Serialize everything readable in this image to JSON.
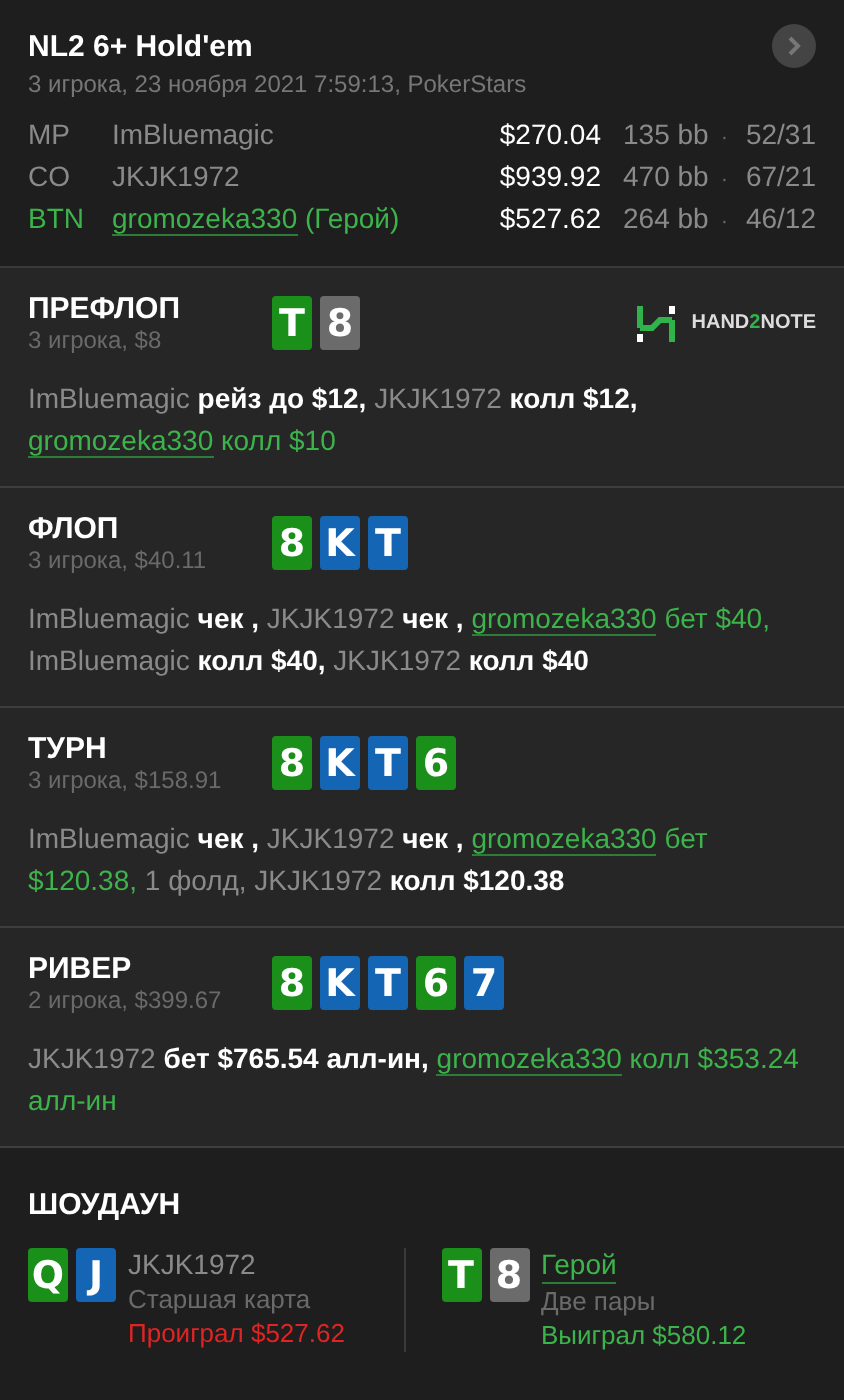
{
  "header": {
    "title": "NL2 6+ Hold'em",
    "subtitle": "3 игрока, 23 ноября 2021 7:59:13, PokerStars"
  },
  "players": [
    {
      "position": "MP",
      "name": "ImBluemagic",
      "hero": false,
      "stack": "$270.04",
      "bb": "135 bb",
      "sep": "·",
      "stats": "52/31"
    },
    {
      "position": "CO",
      "name": "JKJK1972",
      "hero": false,
      "stack": "$939.92",
      "bb": "470 bb",
      "sep": "·",
      "stats": "67/21"
    },
    {
      "position": "BTN",
      "name": "gromozeka330",
      "hero": true,
      "hero_tag": " (Герой)",
      "stack": "$527.62",
      "bb": "264 bb",
      "sep": "·",
      "stats": "46/12"
    }
  ],
  "logo": {
    "before": "HAND",
    "accent": "2",
    "after": "NOTE"
  },
  "streets": [
    {
      "name": "ПРЕФЛОП",
      "info": "3 игрока, $8",
      "logo": true,
      "cards": [
        {
          "rank": "T",
          "color": "#1a8f1a"
        },
        {
          "rank": "8",
          "color": "#6b6b6b"
        }
      ],
      "actions": [
        {
          "kind": "player",
          "text": "ImBluemagic"
        },
        {
          "kind": "action",
          "text": " рейз до $12, "
        },
        {
          "kind": "player",
          "text": "JKJK1972"
        },
        {
          "kind": "action",
          "text": " колл $12, "
        },
        {
          "kind": "hero",
          "text": "gromozeka330"
        },
        {
          "kind": "hero-action",
          "text": " колл $10"
        }
      ]
    },
    {
      "name": "ФЛОП",
      "info": "3 игрока, $40.11",
      "logo": false,
      "cards": [
        {
          "rank": "8",
          "color": "#1a8f1a"
        },
        {
          "rank": "K",
          "color": "#1565b5"
        },
        {
          "rank": "T",
          "color": "#1565b5"
        }
      ],
      "actions": [
        {
          "kind": "player",
          "text": "ImBluemagic"
        },
        {
          "kind": "action",
          "text": " чек , "
        },
        {
          "kind": "player",
          "text": "JKJK1972"
        },
        {
          "kind": "action",
          "text": " чек , "
        },
        {
          "kind": "hero",
          "text": "gromozeka330"
        },
        {
          "kind": "hero-action",
          "text": " бет $40, "
        },
        {
          "kind": "player",
          "text": "ImBluemagic"
        },
        {
          "kind": "action",
          "text": " колл $40, "
        },
        {
          "kind": "player",
          "text": "JKJK1972"
        },
        {
          "kind": "action",
          "text": " колл $40"
        }
      ]
    },
    {
      "name": "ТУРН",
      "info": "3 игрока, $158.91",
      "logo": false,
      "cards": [
        {
          "rank": "8",
          "color": "#1a8f1a"
        },
        {
          "rank": "K",
          "color": "#1565b5"
        },
        {
          "rank": "T",
          "color": "#1565b5"
        },
        {
          "rank": "6",
          "color": "#1a8f1a"
        }
      ],
      "actions": [
        {
          "kind": "player",
          "text": "ImBluemagic"
        },
        {
          "kind": "action",
          "text": " чек , "
        },
        {
          "kind": "player",
          "text": "JKJK1972"
        },
        {
          "kind": "action",
          "text": " чек , "
        },
        {
          "kind": "hero",
          "text": "gromozeka330"
        },
        {
          "kind": "hero-action",
          "text": " бет $120.38, "
        },
        {
          "kind": "player",
          "text": "1 фолд, JKJK1972"
        },
        {
          "kind": "action",
          "text": " колл $120.38"
        }
      ]
    },
    {
      "name": "РИВЕР",
      "info": "2 игрока, $399.67",
      "logo": false,
      "cards": [
        {
          "rank": "8",
          "color": "#1a8f1a"
        },
        {
          "rank": "K",
          "color": "#1565b5"
        },
        {
          "rank": "T",
          "color": "#1565b5"
        },
        {
          "rank": "6",
          "color": "#1a8f1a"
        },
        {
          "rank": "7",
          "color": "#1565b5"
        }
      ],
      "actions": [
        {
          "kind": "player",
          "text": "JKJK1972"
        },
        {
          "kind": "action",
          "text": " бет $765.54 алл-ин, "
        },
        {
          "kind": "hero",
          "text": "gromozeka330"
        },
        {
          "kind": "hero-action",
          "text": " колл $353.24 алл-ин"
        }
      ]
    }
  ],
  "showdown": {
    "title": "ШОУДАУН",
    "hands": [
      {
        "cards": [
          {
            "rank": "Q",
            "color": "#1a8f1a"
          },
          {
            "rank": "J",
            "color": "#1565b5"
          }
        ],
        "name": "JKJK1972",
        "hero": false,
        "rank_text": "Старшая карта",
        "result": "Проиграл $527.62",
        "won": false
      },
      {
        "cards": [
          {
            "rank": "T",
            "color": "#1a8f1a"
          },
          {
            "rank": "8",
            "color": "#6b6b6b"
          }
        ],
        "name": "Герой",
        "hero": true,
        "rank_text": "Две пары",
        "result": "Выиграл $580.12",
        "won": true
      }
    ]
  }
}
